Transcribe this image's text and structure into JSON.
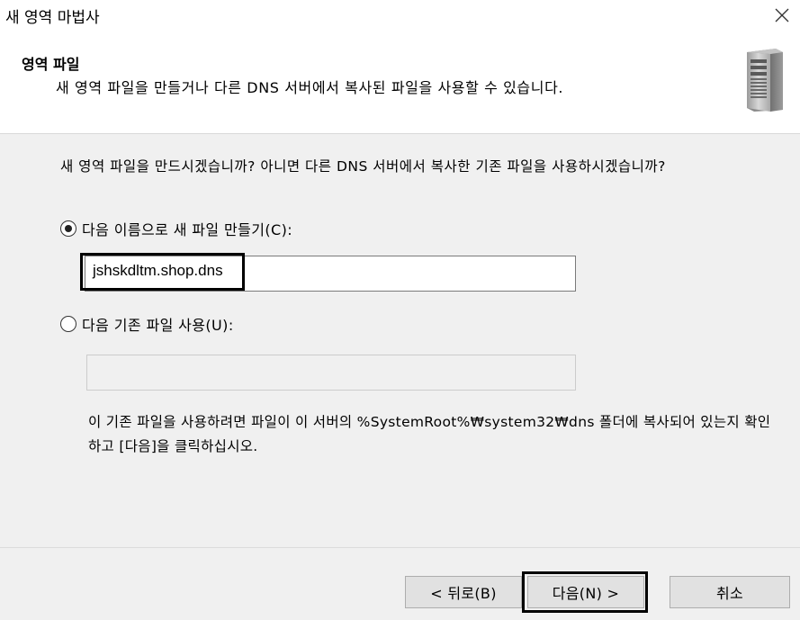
{
  "window": {
    "title": "새 영역 마법사"
  },
  "header": {
    "title": "영역 파일",
    "subtitle": "새 영역 파일을 만들거나 다른 DNS 서버에서 복사된 파일을 사용할 수 있습니다."
  },
  "body": {
    "question": "새 영역 파일을 만드시겠습니까? 아니면 다른 DNS 서버에서 복사한 기존 파일을 사용하시겠습니까?",
    "option_create_label": "다음 이름으로 새 파일 만들기(C):",
    "create_filename_value": "jshskdltm.shop.dns",
    "option_existing_label": "다음 기존 파일 사용(U):",
    "existing_filename_value": "",
    "note": "이 기존 파일을 사용하려면 파일이 이 서버의 %SystemRoot%₩system32₩dns 폴더에 복사되어 있는지 확인하고 [다음]을 클릭하십시오."
  },
  "footer": {
    "back_label": "< 뒤로(B)",
    "next_label": "다음(N) >",
    "cancel_label": "취소"
  },
  "colors": {
    "window_bg": "#f0f0f0",
    "header_bg": "#ffffff",
    "button_bg": "#e1e1e1",
    "highlight_border": "#000000"
  },
  "icons": {
    "close": "close-icon",
    "server": "server-icon"
  }
}
